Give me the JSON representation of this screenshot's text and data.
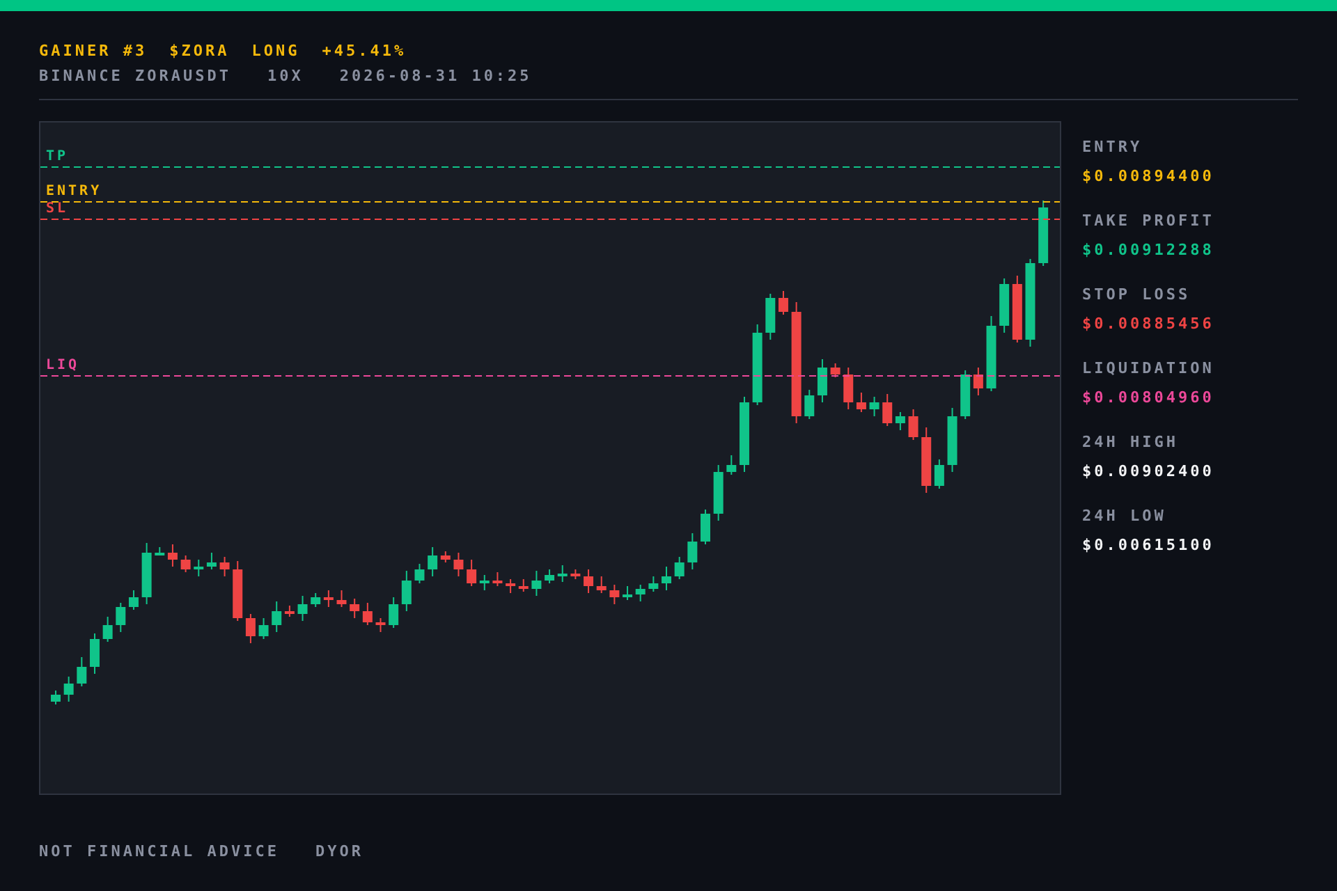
{
  "header": {
    "tags": [
      {
        "text": "GAINER #3"
      },
      {
        "text": "$ZORA"
      },
      {
        "text": "LONG"
      },
      {
        "text": "+45.41%"
      }
    ],
    "meta": [
      "BINANCE ZORAUSDT",
      "10X",
      "2026-08-31 10:25"
    ]
  },
  "chart_levels": [
    {
      "label": "TP",
      "color": "#10c48a"
    },
    {
      "label": "ENTRY",
      "color": "#f5b90b"
    },
    {
      "label": "SL",
      "color": "#ef4444"
    },
    {
      "label": "LIQ",
      "color": "#ec4899"
    }
  ],
  "stats": [
    {
      "label": "ENTRY",
      "value": "$0.00894400",
      "color": "#f5b90b"
    },
    {
      "label": "TAKE PROFIT",
      "value": "$0.00912288",
      "color": "#10c48a"
    },
    {
      "label": "STOP LOSS",
      "value": "$0.00885456",
      "color": "#ef4444"
    },
    {
      "label": "LIQUIDATION",
      "value": "$0.00804960",
      "color": "#ec4899"
    },
    {
      "label": "24H HIGH",
      "value": "$0.00902400",
      "color": "#f3f4f6"
    },
    {
      "label": "24H LOW",
      "value": "$0.00615100",
      "color": "#f3f4f6"
    }
  ],
  "footer": [
    "NOT FINANCIAL ADVICE",
    "DYOR"
  ]
}
